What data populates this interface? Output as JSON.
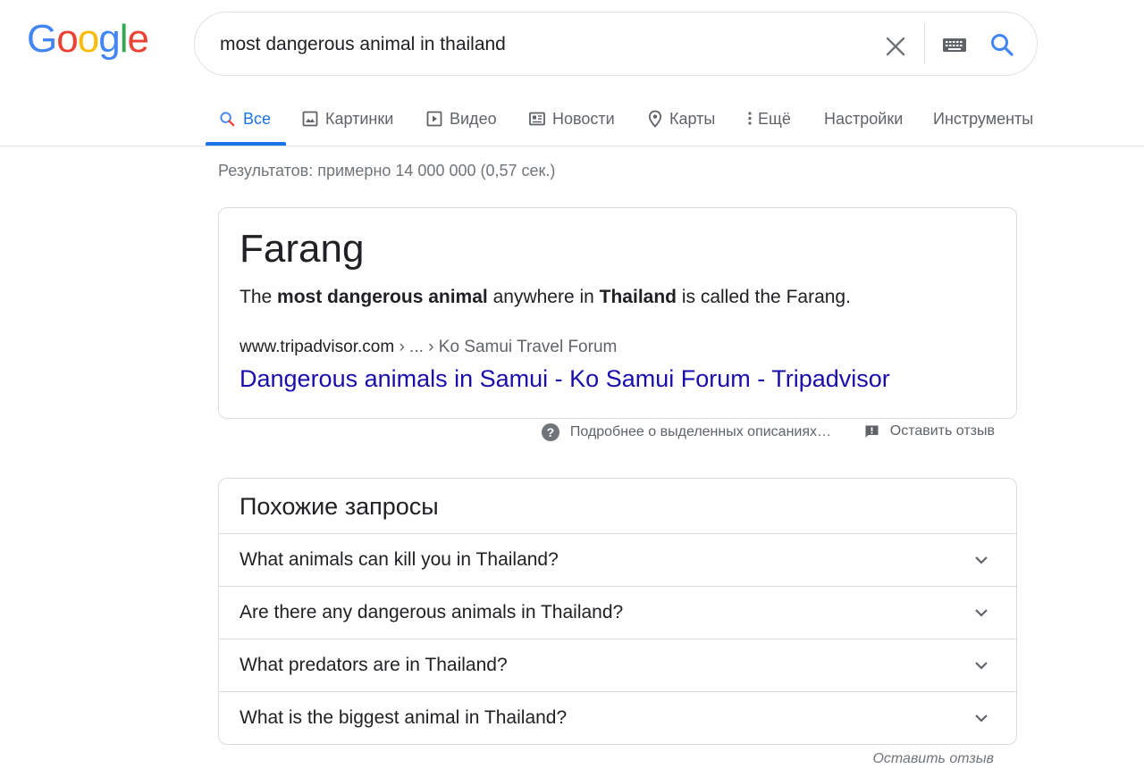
{
  "logo": {
    "letters": [
      {
        "ch": "G",
        "color": "#4285F4"
      },
      {
        "ch": "o",
        "color": "#EA4335"
      },
      {
        "ch": "o",
        "color": "#FBBC05"
      },
      {
        "ch": "g",
        "color": "#4285F4"
      },
      {
        "ch": "l",
        "color": "#34A853"
      },
      {
        "ch": "e",
        "color": "#EA4335"
      }
    ]
  },
  "search": {
    "query": "most dangerous animal in thailand",
    "clear_icon": "close-icon",
    "keyboard_icon": "keyboard-icon",
    "search_icon": "search-icon"
  },
  "tabs": [
    {
      "label": "Все",
      "icon": "search-icon",
      "active": true
    },
    {
      "label": "Картинки",
      "icon": "image-icon",
      "active": false
    },
    {
      "label": "Видео",
      "icon": "video-icon",
      "active": false
    },
    {
      "label": "Новости",
      "icon": "news-icon",
      "active": false
    },
    {
      "label": "Карты",
      "icon": "map-pin-icon",
      "active": false
    },
    {
      "label": "Ещё",
      "icon": "more-vert-icon",
      "active": false
    },
    {
      "label": "Настройки",
      "active": false
    },
    {
      "label": "Инструменты",
      "active": false
    }
  ],
  "stats": "Результатов: примерно 14 000 000 (0,57 сек.)",
  "featured_snippet": {
    "answer": "Farang",
    "description": {
      "p1": "The ",
      "b1": "most dangerous animal",
      "p2": " anywhere in ",
      "b2": "Thailand",
      "p3": " is called the Farang."
    },
    "cite_domain": "www.tripadvisor.com",
    "cite_path": " › ... › Ko Samui Travel Forum",
    "link_text": "Dangerous animals in Samui - Ko Samui Forum - Tripadvisor",
    "about_text": "Подробнее о выделенных описаниях…",
    "feedback_text": "Оставить отзыв"
  },
  "related": {
    "title": "Похожие запросы",
    "questions": [
      "What animals can kill you in Thailand?",
      "Are there any dangerous animals in Thailand?",
      "What predators are in Thailand?",
      "What is the biggest animal in Thailand?"
    ],
    "feedback_text": "Оставить отзыв"
  },
  "colors": {
    "link": "#1a0dab",
    "accent": "#1a73e8",
    "muted": "#5f6368",
    "border": "#dadce0"
  }
}
